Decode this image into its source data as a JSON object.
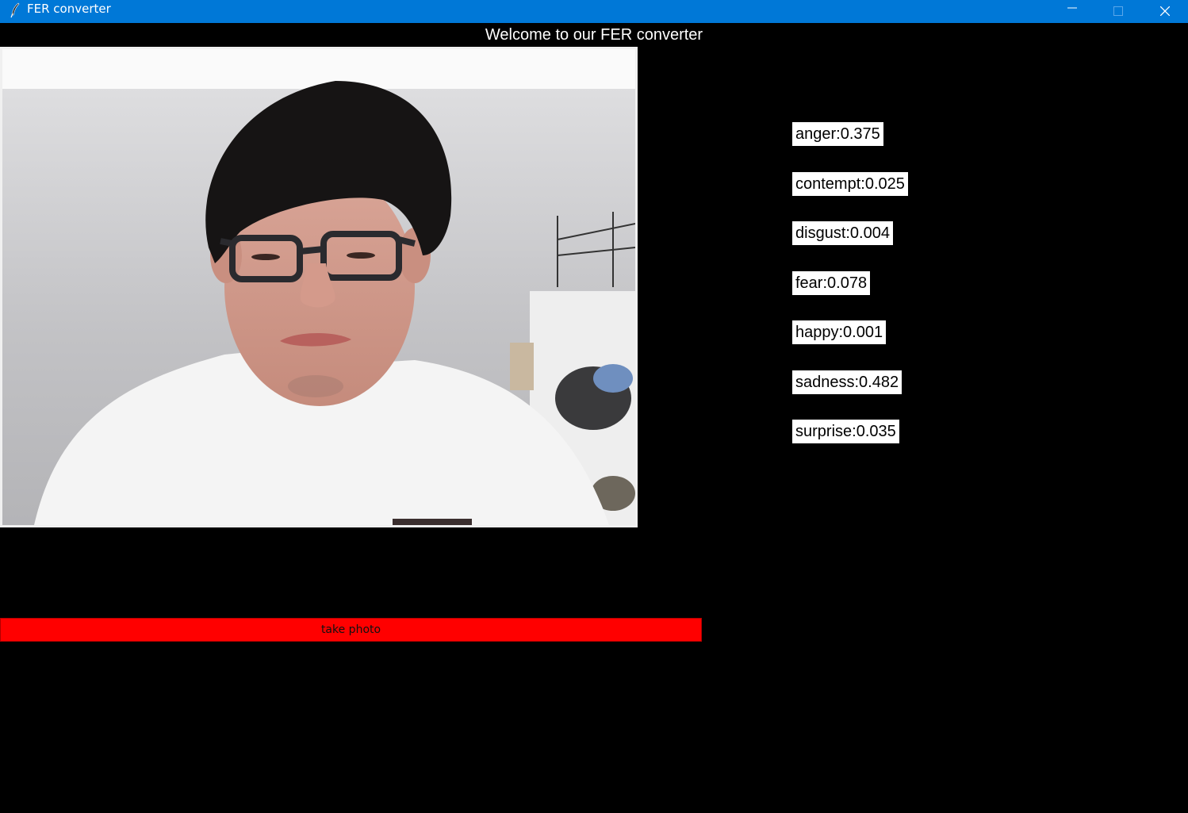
{
  "window": {
    "title": "FER converter",
    "controls": [
      "minimize-icon",
      "maximize-icon",
      "close-icon"
    ],
    "titlebar_color": "#0078d7"
  },
  "header": {
    "welcome": "Welcome to our FER converter"
  },
  "camera": {
    "content": "webcam photo of a person"
  },
  "emotions": [
    {
      "label": "anger:0.375"
    },
    {
      "label": "contempt:0.025"
    },
    {
      "label": "disgust:0.004"
    },
    {
      "label": "fear:0.078"
    },
    {
      "label": "happy:0.001"
    },
    {
      "label": "sadness:0.482"
    },
    {
      "label": "surprise:0.035"
    }
  ],
  "actions": {
    "take_photo": "take photo",
    "button_color": "#ff0000"
  }
}
